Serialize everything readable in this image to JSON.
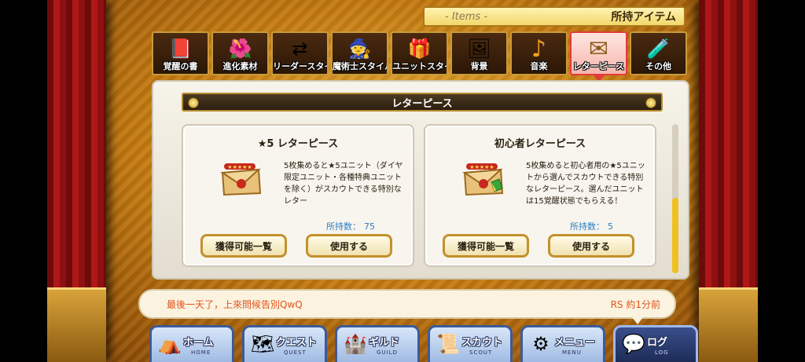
{
  "header": {
    "subtitle": "- Items -",
    "title": "所持アイテム"
  },
  "tabs": [
    {
      "label": "覚醒の書",
      "icon": "book-icon",
      "glyph": "📕",
      "active": false
    },
    {
      "label": "進化素材",
      "icon": "flower-icon",
      "glyph": "🌺",
      "active": false
    },
    {
      "label": "リーダースタイル",
      "icon": "swap-icon",
      "glyph": "⇄",
      "active": false
    },
    {
      "label": "魔術士スタイル",
      "icon": "wizard-icon",
      "glyph": "🧙",
      "active": false
    },
    {
      "label": "ユニットスタイル",
      "icon": "gift-icon",
      "glyph": "🎁",
      "active": false
    },
    {
      "label": "背景",
      "icon": "landscape-icon",
      "glyph": "🖼",
      "active": false
    },
    {
      "label": "音楽",
      "icon": "music-note-icon",
      "glyph": "♪",
      "active": false
    },
    {
      "label": "レターピース",
      "icon": "letter-icon",
      "glyph": "✉",
      "active": true
    },
    {
      "label": "その他",
      "icon": "misc-items-icon",
      "glyph": "🧪",
      "active": false
    }
  ],
  "section": {
    "title": "レターピース"
  },
  "cards": [
    {
      "title": "★5 レターピース",
      "description": "5枚集めると★5ユニット（ダイヤ限定ユニット・各種特典ユニットを除く）がスカウトできる特別なレター",
      "count_label": "所持数：",
      "count": "75",
      "list_button": "獲得可能一覧",
      "use_button": "使用する"
    },
    {
      "title": "初心者レターピース",
      "description": "5枚集めると初心者用の★5ユニットから選んでスカウトできる特別なレターピース。選んだユニットは15覚醒状態でもらえる！",
      "count_label": "所持数：",
      "count": "5",
      "list_button": "獲得可能一覧",
      "use_button": "使用する"
    }
  ],
  "chat": {
    "message": "最後一天了，上來問候告別QwQ",
    "meta": "RS 約1分前"
  },
  "nav": [
    {
      "label": "ホーム",
      "sub": "HOME",
      "icon": "tent-icon",
      "glyph": "⛺"
    },
    {
      "label": "クエスト",
      "sub": "QUEST",
      "icon": "map-icon",
      "glyph": "🗺"
    },
    {
      "label": "ギルド",
      "sub": "GUILD",
      "icon": "castle-icon",
      "glyph": "🏰"
    },
    {
      "label": "スカウト",
      "sub": "SCOUT",
      "icon": "scout-board-icon",
      "glyph": "📜"
    },
    {
      "label": "メニュー",
      "sub": "MENU",
      "icon": "gear-icon",
      "glyph": "⚙"
    },
    {
      "label": "ログ",
      "sub": "LOG",
      "icon": "chat-bubble-icon",
      "glyph": "💬"
    }
  ]
}
